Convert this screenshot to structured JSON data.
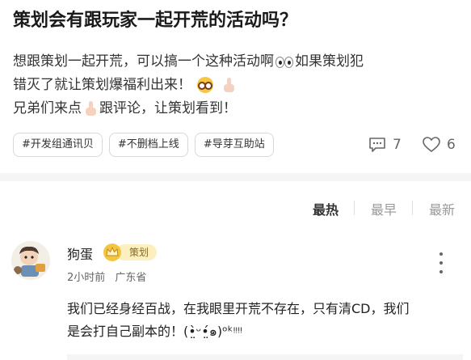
{
  "post": {
    "title": "策划会有跟玩家一起开荒的活动吗？",
    "body_line1_text": "想跟策划一起开荒，可以搞一个这种活动啊",
    "body_line1_suffix": "如果策划犯",
    "body_line2_text": "错灭了就让策划爆福利出来！",
    "body_line3_text": "兄弟们来点",
    "body_line3_suffix": "跟评论，让策划看到！",
    "emoji_icons": [
      "eyes-icon",
      "nerd-face-icon",
      "pointing-up-icon",
      "thumbs-up-icon"
    ],
    "tags": [
      "#开发组通讯贝",
      "#不删档上线",
      "#导芽互助站"
    ],
    "comment_count": "7",
    "like_count": "6"
  },
  "sort_tabs": [
    "最热",
    "最早",
    "最新"
  ],
  "comment": {
    "username": "狗蛋",
    "badge_label": "策划",
    "time": "2小时前",
    "location": "广东省",
    "text_line1": "我们已经身经百战，在我眼里开荒不存在，只有清CD，我们",
    "text_line2": "是会打自己副本的！(•̤̀ᵕ•̤́๑)ᵒᵏᵎᵎᵎᵎ"
  },
  "colors": {
    "badge_bg": "#fdf0c0",
    "divider": "#f5f5f5",
    "muted": "#999999"
  }
}
